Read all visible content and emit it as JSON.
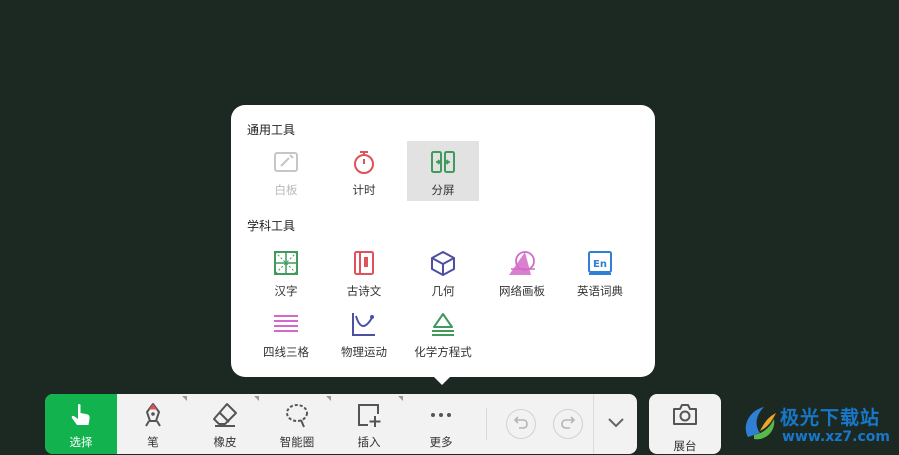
{
  "panel": {
    "general_title": "通用工具",
    "general_tools": [
      {
        "label": "白板",
        "icon": "whiteboard-icon",
        "state": "disabled"
      },
      {
        "label": "计时",
        "icon": "timer-icon",
        "state": "normal"
      },
      {
        "label": "分屏",
        "icon": "split-screen-icon",
        "state": "selected"
      }
    ],
    "subject_title": "学科工具",
    "subject_tools": [
      {
        "label": "汉字",
        "icon": "chinese-character-grid-icon"
      },
      {
        "label": "古诗文",
        "icon": "ancient-poetry-book-icon"
      },
      {
        "label": "几何",
        "icon": "geometry-cube-icon"
      },
      {
        "label": "网络画板",
        "icon": "network-drawing-board-icon"
      },
      {
        "label": "英语词典",
        "icon": "english-dictionary-icon"
      },
      {
        "label": "四线三格",
        "icon": "four-line-grid-icon"
      },
      {
        "label": "物理运动",
        "icon": "physics-motion-icon"
      },
      {
        "label": "化学方程式",
        "icon": "chemical-equation-icon"
      }
    ]
  },
  "toolbar": {
    "select": "选择",
    "pen": "笔",
    "eraser": "橡皮",
    "smart_lasso": "智能圈",
    "insert": "插入",
    "more": "更多",
    "booth": "展台"
  },
  "watermark": {
    "name": "极光下载站",
    "url": "www.xz7.com"
  },
  "colors": {
    "background": "#1c2922",
    "accent_green": "#12b34f",
    "red": "#e0525a",
    "green": "#3f9a5c",
    "purple": "#4e4fa3",
    "pink": "#d36ac8",
    "blue": "#2f7fd4"
  }
}
